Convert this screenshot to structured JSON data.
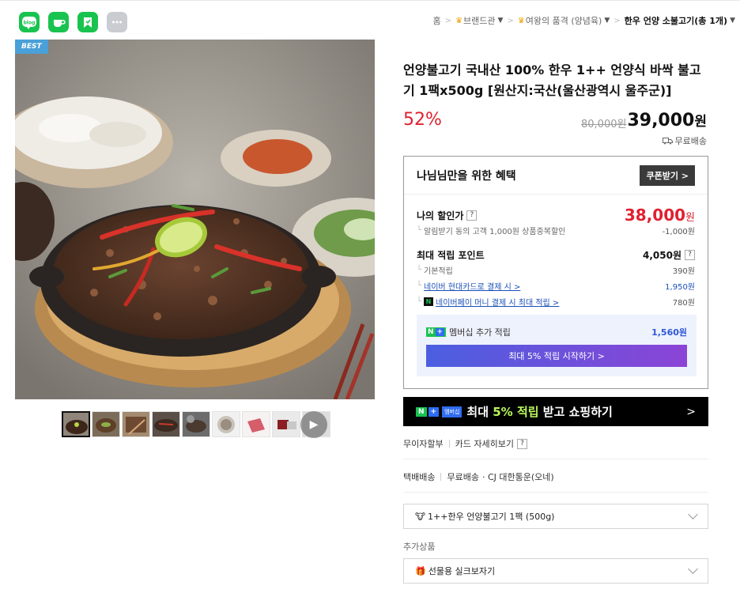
{
  "share": {
    "icons": [
      "blog-icon",
      "cafe-icon",
      "bookmark-icon",
      "more-icon"
    ],
    "blog_label": "blog"
  },
  "breadcrumb": {
    "home": "홈",
    "brand": "브랜드관",
    "category": "여왕의 품격 (양념육)",
    "current": "한우 언양 소불고기",
    "count_prefix": "(총 ",
    "count_num": "1",
    "count_suffix": "개)"
  },
  "product": {
    "badge": "BEST",
    "title": "언양불고기 국내산 100% 한우 1++ 언양식 바싹 불고기 1팩x500g [원산지:국산(울산광역시 울주군)]",
    "discount_pct": "52%",
    "original_price": "80,000원",
    "final_price": "39,000",
    "final_unit": "원",
    "shipping": "무료배송"
  },
  "benefit": {
    "heading": "나님님만을 위한 혜택",
    "coupon_button": "쿠폰받기 >",
    "my_price_label": "나의 할인가",
    "my_price": "38,000",
    "my_price_unit": "원",
    "alert_discount_label": "알림받기 동의 고객 1,000원 상품중복할인",
    "alert_discount_value": "-1,000원",
    "max_point_label": "최대 적립 포인트",
    "max_point_value": "4,050원",
    "base_label": "기본적립",
    "base_value": "390원",
    "card_label": "네이버 현대카드로 결제 시 >",
    "card_value": "1,950원",
    "npay_label": "네이버페이 머니 결제 시 최대 적립 >",
    "npay_value": "780원",
    "membership_label": "멤버십 추가 적립",
    "membership_value": "1,560원",
    "membership_button": "최대 5% 적립 시작하기 >"
  },
  "banner": {
    "membership_tag": "멤버십",
    "text_pre": "최대 ",
    "text_hl": "5% 적립",
    "text_post": " 받고 쇼핑하기",
    "arrow": ">"
  },
  "installment": {
    "label": "무이자할부",
    "card_detail": "카드 자세히보기"
  },
  "delivery": {
    "type": "택배배송",
    "fee": "무료배송",
    "carrier": "· CJ 대한통운(오네)"
  },
  "options": {
    "main_option": "1++한우 언양불고기 1팩 (500g)",
    "extra_label": "추가상품",
    "extra_option": "선물용 실크보자기"
  },
  "colors": {
    "sale_red": "#e0202f",
    "naver_green": "#19c34f",
    "link_blue": "#1a4fb8"
  }
}
